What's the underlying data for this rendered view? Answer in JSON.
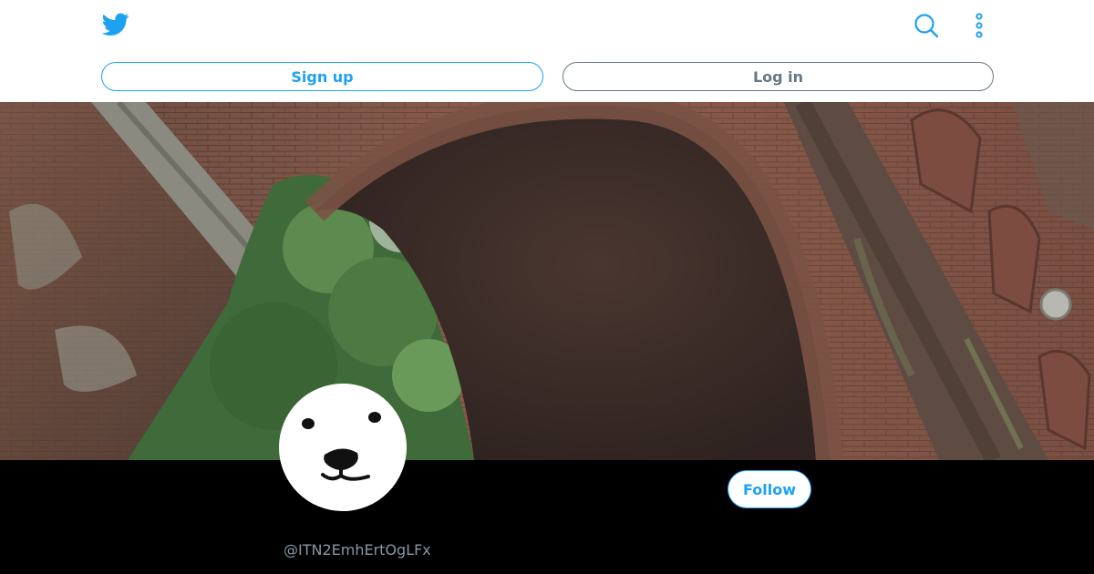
{
  "header": {
    "logo_icon": "twitter-bird-icon",
    "search_icon": "search-icon",
    "more_icon": "more-vertical-icon",
    "signup_label": "Sign up",
    "login_label": "Log in"
  },
  "profile": {
    "handle": "@ITN2EmhErtOgLFx",
    "follow_label": "Follow",
    "avatar_icon": "seal-face-avatar"
  },
  "colors": {
    "brand": "#1da1f2",
    "secondary": "#657786",
    "handle_text": "#8899a6",
    "profile_background": "#000000"
  }
}
